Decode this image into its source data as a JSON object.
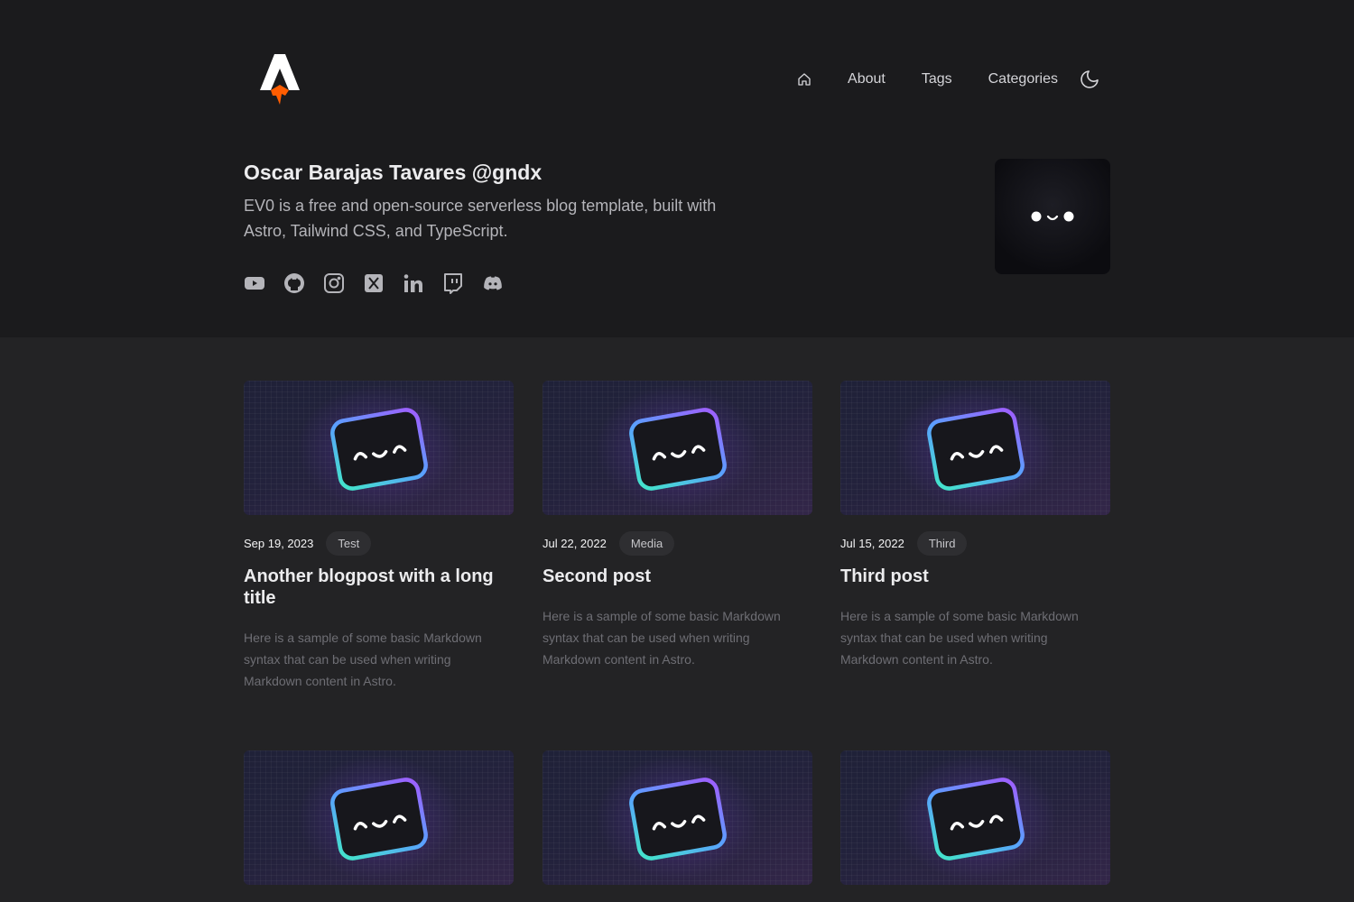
{
  "header": {
    "logo_icon": "astro-rocket-logo",
    "nav": {
      "home_icon": "home-icon",
      "items": [
        "About",
        "Tags",
        "Categories"
      ],
      "theme_icon": "moon-icon"
    }
  },
  "profile": {
    "name": "Oscar Barajas Tavares @gndx",
    "description": "EV0 is a free and open-source serverless blog template, built with Astro, Tailwind CSS, and TypeScript.",
    "socials": [
      "youtube-icon",
      "github-icon",
      "instagram-icon",
      "x-icon",
      "linkedin-icon",
      "twitch-icon",
      "discord-icon"
    ]
  },
  "posts": [
    {
      "date": "Sep 19, 2023",
      "tag": "Test",
      "title": "Another blogpost with a long title",
      "excerpt": "Here is a sample of some basic Markdown syntax that can be used when writing Markdown content in Astro."
    },
    {
      "date": "Jul 22, 2022",
      "tag": "Media",
      "title": "Second post",
      "excerpt": "Here is a sample of some basic Markdown syntax that can be used when writing Markdown content in Astro."
    },
    {
      "date": "Jul 15, 2022",
      "tag": "Third",
      "title": "Third post",
      "excerpt": "Here is a sample of some basic Markdown syntax that can be used when writing Markdown content in Astro."
    },
    {
      "date": "",
      "tag": "",
      "title": "",
      "excerpt": ""
    },
    {
      "date": "",
      "tag": "",
      "title": "",
      "excerpt": ""
    },
    {
      "date": "",
      "tag": "",
      "title": "",
      "excerpt": ""
    }
  ],
  "colors": {
    "hero_bg": "#1b1b1d",
    "page_bg": "#232325",
    "accent_orange": "#ff5d01"
  }
}
